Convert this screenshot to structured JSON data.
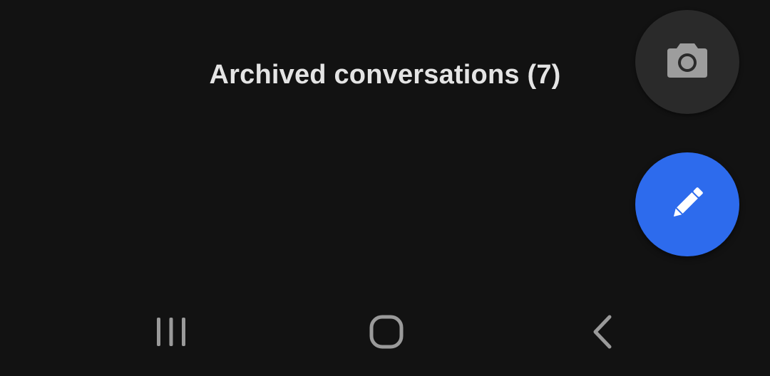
{
  "main": {
    "archived_label": "Archived conversations (7)"
  },
  "fabs": {
    "camera": {
      "icon": "camera-icon",
      "color": "#2a2a2a"
    },
    "compose": {
      "icon": "pencil-icon",
      "color": "#2d6bed"
    }
  },
  "navigation": {
    "recents_icon": "recents-icon",
    "home_icon": "home-icon",
    "back_icon": "back-icon"
  },
  "colors": {
    "background": "#121212",
    "text": "#e4e4e4",
    "nav_icon": "#9a9a9a"
  }
}
